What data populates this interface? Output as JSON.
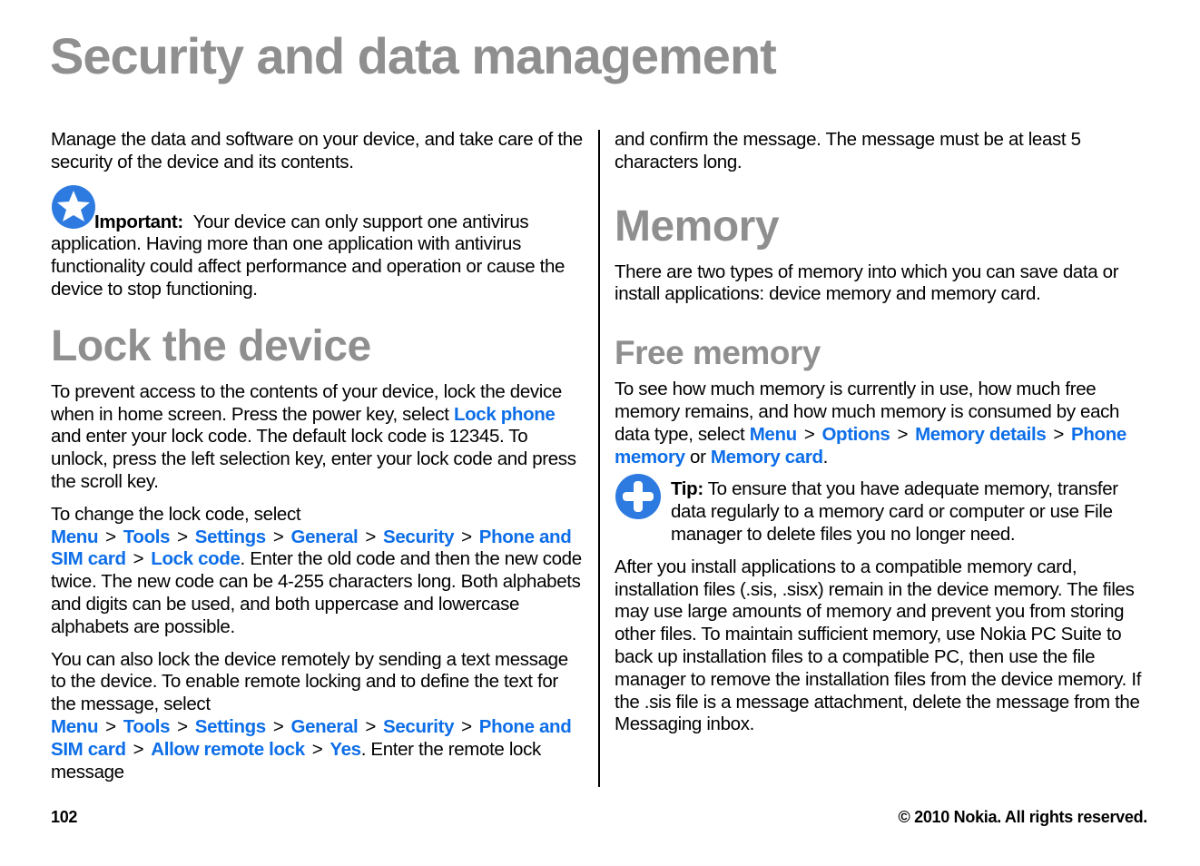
{
  "page": {
    "title": "Security and data management",
    "page_number": "102",
    "copyright": "© 2010 Nokia. All rights reserved."
  },
  "left": {
    "intro": "Manage the data and software on your device, and take care of the security of the device and its contents.",
    "important": {
      "icon": "star-icon",
      "label": "Important:",
      "text": "Your device can only support one antivirus application. Having more than one application with antivirus functionality could affect performance and operation or cause the device to stop functioning."
    },
    "lock_heading": "Lock the device",
    "lock_p1": {
      "before": "To prevent access to the contents of your device, lock the device when in home screen. Press the power key, select ",
      "link": "Lock phone",
      "after": " and enter your lock code. The default lock code is 12345. To unlock, press the left selection key, enter your lock code and press the scroll key."
    },
    "lock_p2": {
      "before": "To change the lock code, select ",
      "path": [
        "Menu",
        "Tools",
        "Settings",
        "General",
        "Security",
        "Phone and SIM card",
        "Lock code"
      ],
      "after": ". Enter the old code and then the new code twice. The new code can be 4-255 characters long. Both alphabets and digits can be used, and both uppercase and lowercase alphabets are possible."
    },
    "lock_p3": {
      "before": "You can also lock the device remotely by sending a text message to the device. To enable remote locking and to define the text for the message, select ",
      "path": [
        "Menu",
        "Tools",
        "Settings",
        "General",
        "Security",
        "Phone and SIM card",
        "Allow remote lock",
        "Yes"
      ],
      "after": ". Enter the remote lock message"
    },
    "separator": ">"
  },
  "right": {
    "continuation": "and confirm the message. The message must be at least 5 characters long.",
    "memory_heading": "Memory",
    "memory_intro": "There are two types of memory into which you can save data or install applications: device memory and memory card.",
    "free_heading": "Free memory",
    "free_p1": {
      "before": "To see how much memory is currently in use, how much free memory remains, and how much memory is consumed by each data type, select ",
      "path": [
        "Menu",
        "Options",
        "Memory details",
        "Phone memory"
      ],
      "or": " or ",
      "alt": "Memory card",
      "after": "."
    },
    "tip": {
      "icon": "plus-icon",
      "label": "Tip:",
      "text": " To ensure that you have adequate memory, transfer data regularly to a memory card or computer or use File manager to delete files you no longer need."
    },
    "free_p2": "After you install applications to a compatible memory card, installation files (.sis, .sisx) remain in the device memory. The files may use large amounts of memory and prevent you from storing other files. To maintain sufficient memory, use Nokia PC Suite to back up installation files to a compatible PC, then use the file manager to remove the installation files from the device memory. If the .sis file is a message attachment, delete the message from the Messaging inbox."
  },
  "colors": {
    "heading_gray": "#8f8f8f",
    "link_blue": "#0d6ee8",
    "icon_blue": "#2d7be0"
  }
}
